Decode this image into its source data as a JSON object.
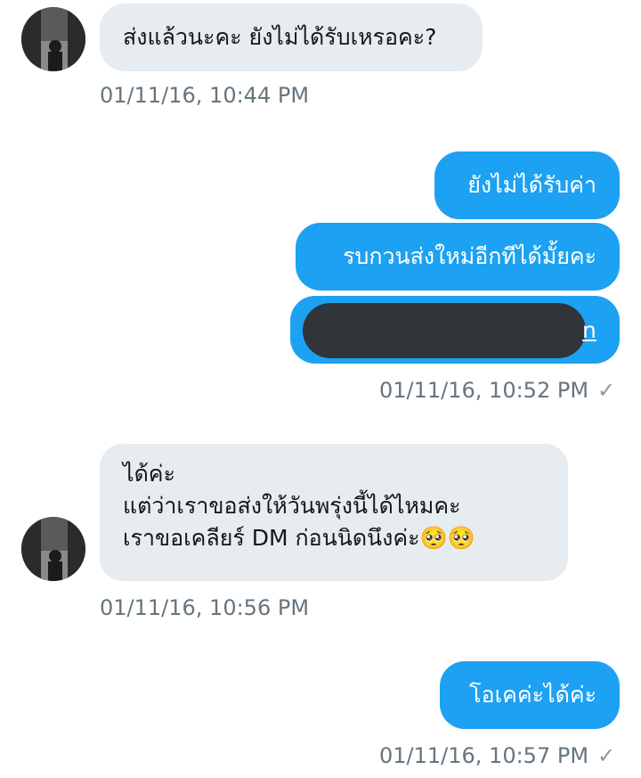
{
  "messages": {
    "m1": {
      "text": "ส่งแล้วนะคะ ยังไม่ได้รับเหรอคะ?",
      "time": "01/11/16, 10:44 PM"
    },
    "m2": {
      "text": "ยังไม่ได้รับค่า"
    },
    "m3": {
      "text": "รบกวนส่งใหม่อีกทีได้มั้ยคะ"
    },
    "m4": {
      "link_tail": "n",
      "time": "01/11/16, 10:52 PM",
      "receipt": "✓"
    },
    "m5": {
      "line1": "ได้ค่ะ",
      "line2": "แต่ว่าเราขอส่งให้วันพรุ่งนี้ได้ไหมคะ",
      "line3": "เราขอเคลียร์ DM ก่อนนิดนึงค่ะ🥺🥺",
      "time": "01/11/16, 10:56 PM"
    },
    "m6": {
      "text": "โอเคค่ะได้ค่ะ",
      "time": "01/11/16, 10:57 PM",
      "receipt": "✓"
    }
  },
  "colors": {
    "incoming_bubble": "#e6ecf0",
    "outgoing_bubble": "#1da1f2",
    "timestamp": "#66757f",
    "redaction": "#30353a"
  },
  "icons": {
    "avatar": "user-avatar-photo",
    "read_receipt": "checkmark-icon"
  }
}
